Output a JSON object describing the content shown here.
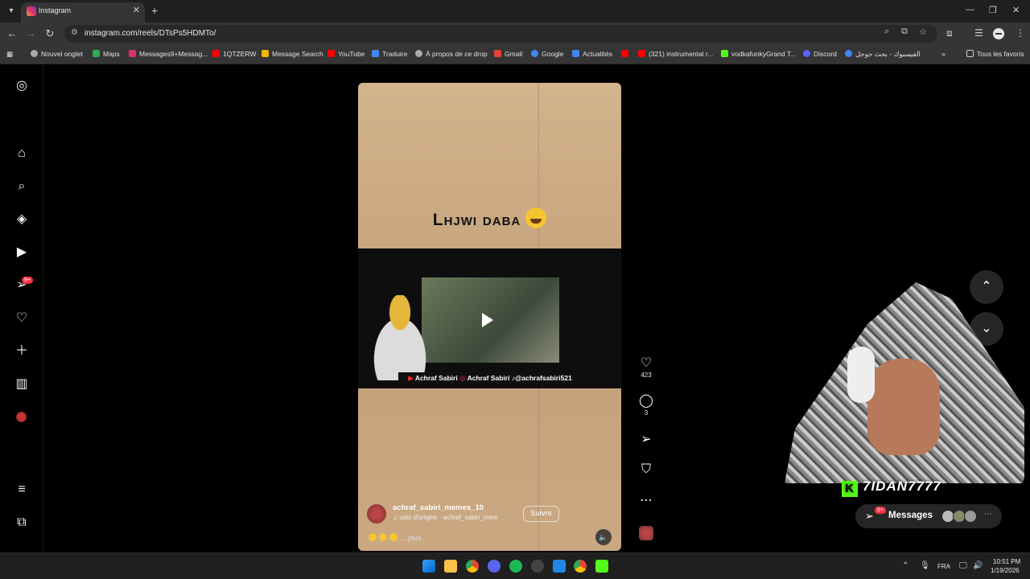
{
  "browser": {
    "tab_title": "Instagram",
    "url": "instagram.com/reels/DTsPs5HDMTo/",
    "bookmarks": [
      "Nouvel onglet",
      "Maps",
      "Messages9+Messag...",
      "1QTZERW",
      "Message Search",
      "YouTube",
      "Traduire",
      "À propos de ce drop",
      "Gmail",
      "Google",
      "Actualités",
      "",
      "(321) instrumental r...",
      "vodkafunkyGrand T...",
      "Discord",
      "الفيسبوك - بحث جوجل"
    ],
    "all_bookmarks": "Tous les favoris"
  },
  "sidebar": {
    "notification_badge": "9+"
  },
  "reel": {
    "caption": "Lhjwi daba",
    "credits": {
      "youtube": "Achraf Sabiri",
      "instagram": "Achraf Sabiri",
      "tiktok": "achrafsabiri521"
    },
    "author": "achraf_sabiri_memes_10",
    "audio": "udio d'origine · achraf_sabiri_mem",
    "follow_label": "Suivre",
    "description_more": "... plus",
    "likes": "423",
    "comments": "3"
  },
  "overlay": {
    "streamer_name": "7IDAN7777",
    "messages_label": "Messages",
    "messages_badge": "9+"
  },
  "taskbar": {
    "lang": "FRA",
    "time": "10:51 PM",
    "date": "1/19/2026"
  },
  "colors": {
    "accent_red": "#ff3040",
    "kick_green": "#53fc18",
    "reel_paper": "#c8a77f"
  }
}
